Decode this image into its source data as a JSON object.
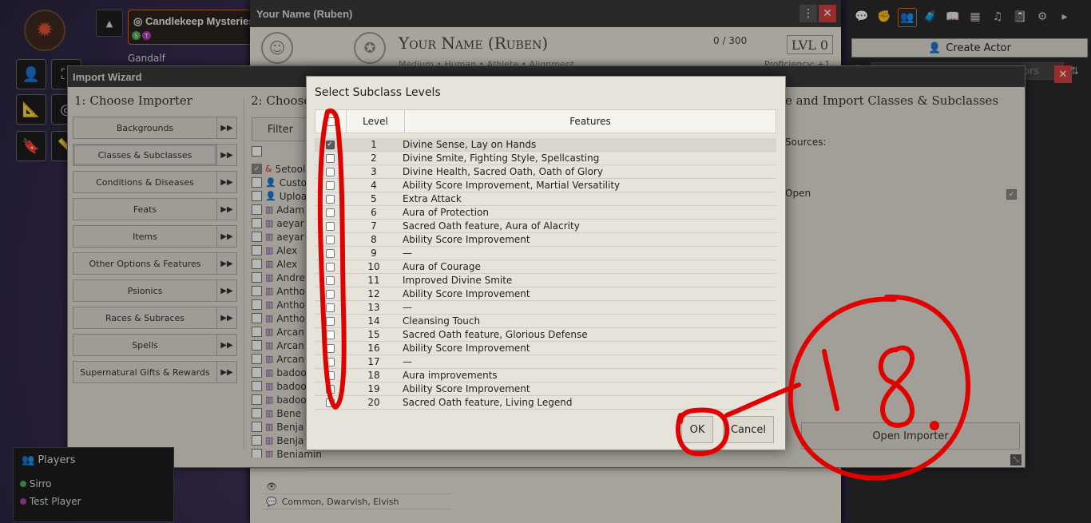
{
  "scene": {
    "title": "Candlekeep Mysteries",
    "badges": [
      "S",
      "T"
    ],
    "user": "Gandalf"
  },
  "sheet": {
    "window_title": "Your Name (Ruben)",
    "name": "Your Name (Ruben)",
    "subtitle": "Medium • Human • Athlete • Alignment",
    "xp": "0 / 300",
    "level": "LVL 0",
    "proficiency": "Proficiency: +1",
    "languages": "Common, Dwarvish, Elvish"
  },
  "sidebar": {
    "create_actor": "Create Actor",
    "search_placeholder": "Search Actors"
  },
  "players": {
    "title": "Players",
    "list": [
      {
        "name": "Sirro",
        "color": "#4caf50"
      },
      {
        "name": "Test Player",
        "color": "#b040b0"
      }
    ]
  },
  "wizard": {
    "title": "Import Wizard",
    "col1_title": "1: Choose Importer",
    "col2_title": "2: Choose",
    "col3_title": "e and Import Classes & Subclasses",
    "sources_label": "Sources:",
    "open_label": "Open",
    "filter_label": "Filter",
    "open_importer": "Open Importer",
    "importers": [
      "Backgrounds",
      "Classes & Subclasses",
      "Conditions & Diseases",
      "Feats",
      "Items",
      "Other Options & Features",
      "Psionics",
      "Races & Subraces",
      "Spells",
      "Supernatural Gifts & Rewards"
    ],
    "sources": [
      "5etools",
      "Custom",
      "Upload",
      "Adam",
      "aeyar",
      "aeyar",
      "Alex",
      "Alex",
      "Andre",
      "Antho",
      "Antho",
      "Antho",
      "Arcan",
      "Arcan",
      "Arcan",
      "badoo",
      "badoo",
      "badoo",
      "Bene",
      "Benja",
      "Benja",
      "Benjamin Huffman: Scholar"
    ]
  },
  "modal": {
    "title": "Select Subclass Levels",
    "col_level": "Level",
    "col_features": "Features",
    "ok": "OK",
    "cancel": "Cancel",
    "rows": [
      {
        "level": "1",
        "features": "Divine Sense, Lay on Hands",
        "checked": true
      },
      {
        "level": "2",
        "features": "Divine Smite, Fighting Style, Spellcasting",
        "checked": false
      },
      {
        "level": "3",
        "features": "Divine Health, Sacred Oath, Oath of Glory",
        "checked": false
      },
      {
        "level": "4",
        "features": "Ability Score Improvement, Martial Versatility",
        "checked": false
      },
      {
        "level": "5",
        "features": "Extra Attack",
        "checked": false
      },
      {
        "level": "6",
        "features": "Aura of Protection",
        "checked": false
      },
      {
        "level": "7",
        "features": "Sacred Oath feature, Aura of Alacrity",
        "checked": false
      },
      {
        "level": "8",
        "features": "Ability Score Improvement",
        "checked": false
      },
      {
        "level": "9",
        "features": "—",
        "checked": false
      },
      {
        "level": "10",
        "features": "Aura of Courage",
        "checked": false
      },
      {
        "level": "11",
        "features": "Improved Divine Smite",
        "checked": false
      },
      {
        "level": "12",
        "features": "Ability Score Improvement",
        "checked": false
      },
      {
        "level": "13",
        "features": "—",
        "checked": false
      },
      {
        "level": "14",
        "features": "Cleansing Touch",
        "checked": false
      },
      {
        "level": "15",
        "features": "Sacred Oath feature, Glorious Defense",
        "checked": false
      },
      {
        "level": "16",
        "features": "Ability Score Improvement",
        "checked": false
      },
      {
        "level": "17",
        "features": "—",
        "checked": false
      },
      {
        "level": "18",
        "features": "Aura improvements",
        "checked": false
      },
      {
        "level": "19",
        "features": "Ability Score Improvement",
        "checked": false
      },
      {
        "level": "20",
        "features": "Sacred Oath feature, Living Legend",
        "checked": false
      }
    ]
  },
  "annotation": {
    "text": "18.",
    "color": "#e00000"
  }
}
